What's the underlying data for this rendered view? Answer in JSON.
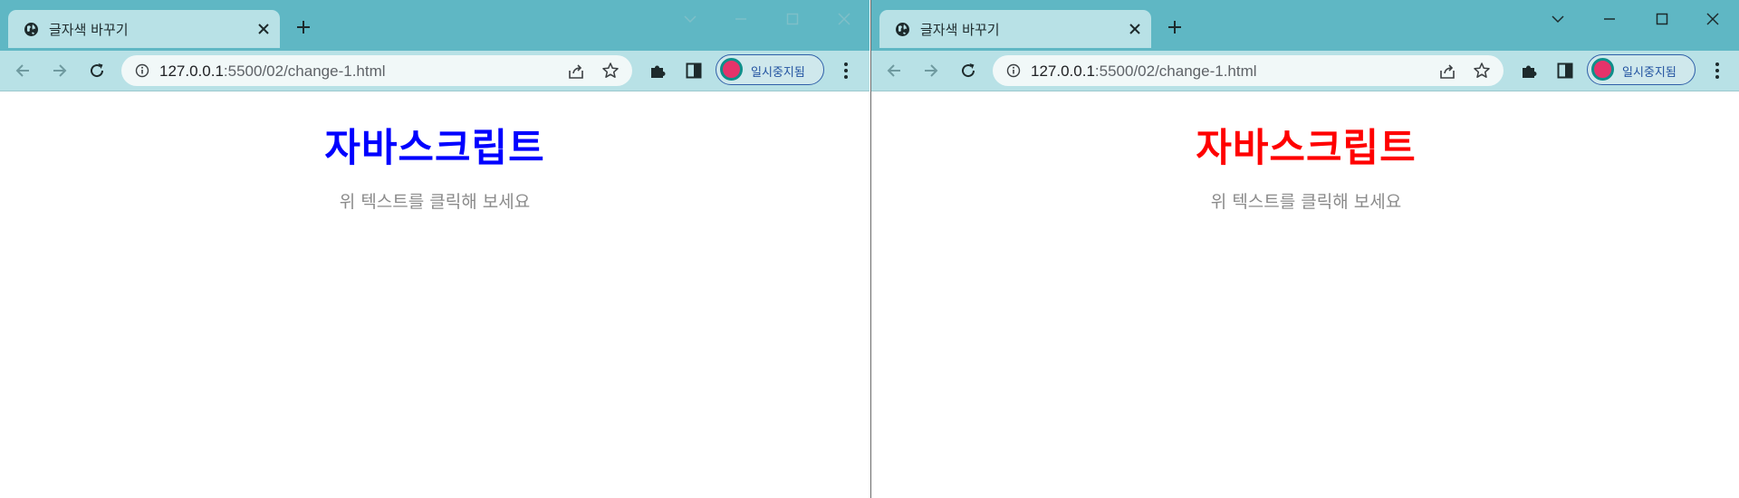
{
  "windows": [
    {
      "tab": {
        "title": "글자색 바꾸기"
      },
      "address": {
        "host": "127.0.0.1",
        "path": ":5500/02/change-1.html"
      },
      "profile": {
        "label": "일시중지됨"
      },
      "page": {
        "heading": "자바스크립트",
        "heading_color": "#0000ff",
        "hint": "위 텍스트를 클릭해 보세요"
      }
    },
    {
      "tab": {
        "title": "글자색 바꾸기"
      },
      "address": {
        "host": "127.0.0.1",
        "path": ":5500/02/change-1.html"
      },
      "profile": {
        "label": "일시중지됨"
      },
      "page": {
        "heading": "자바스크립트",
        "heading_color": "#ff0000",
        "hint": "위 텍스트를 클릭해 보세요"
      }
    }
  ],
  "icons": [
    "globe-icon",
    "close-icon",
    "plus-icon",
    "chevron-down-icon",
    "minimize-icon",
    "maximize-icon",
    "back-arrow-icon",
    "forward-arrow-icon",
    "reload-icon",
    "info-icon",
    "share-icon",
    "star-icon",
    "puzzle-icon",
    "side-panel-icon",
    "kebab-menu-icon"
  ],
  "colors": {
    "titlebar": "#5fb7c4",
    "toolbar": "#b8e1e6",
    "omnibox": "#f1f8f8"
  }
}
